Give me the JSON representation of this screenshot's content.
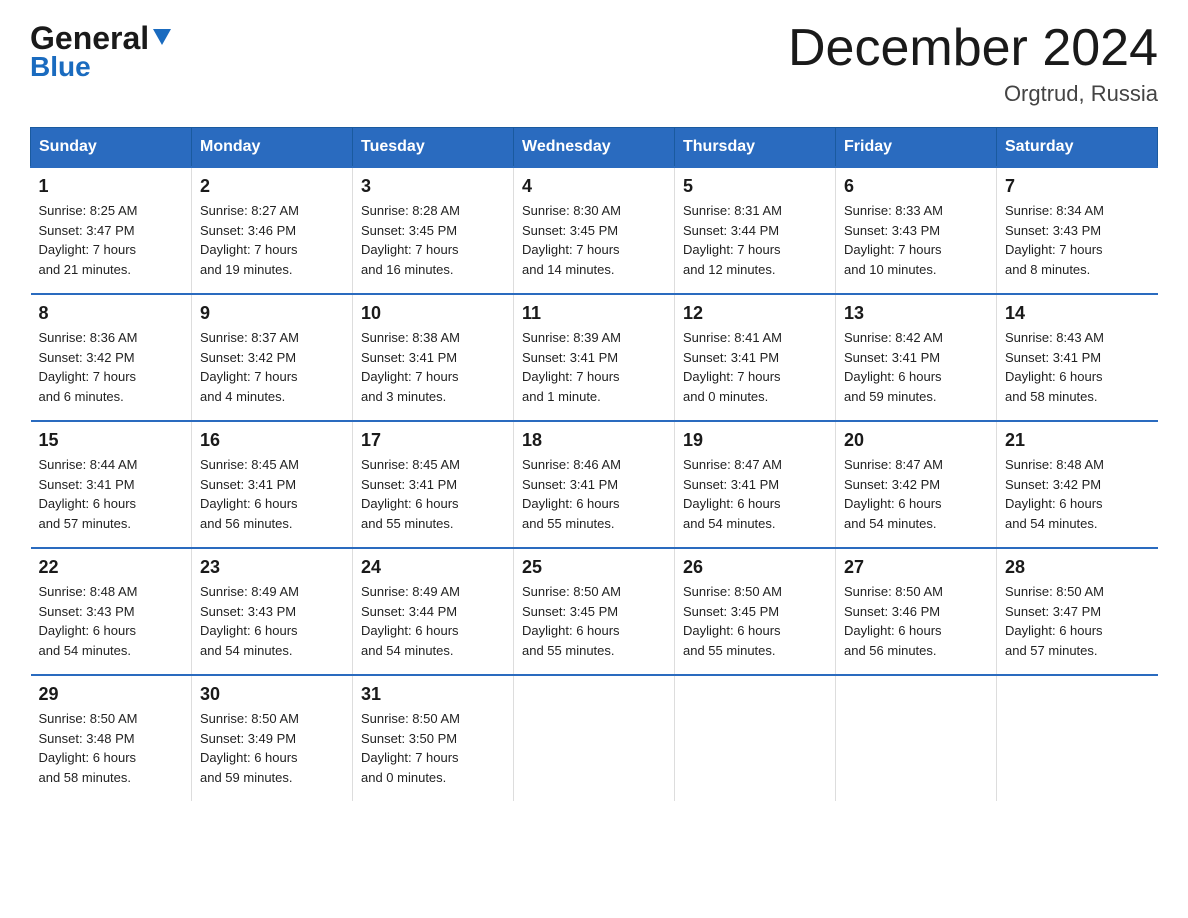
{
  "header": {
    "logo_general": "General",
    "logo_blue": "Blue",
    "title": "December 2024",
    "location": "Orgtrud, Russia"
  },
  "days_of_week": [
    "Sunday",
    "Monday",
    "Tuesday",
    "Wednesday",
    "Thursday",
    "Friday",
    "Saturday"
  ],
  "weeks": [
    [
      {
        "day": "1",
        "sunrise": "8:25 AM",
        "sunset": "3:47 PM",
        "daylight_hours": "7",
        "daylight_minutes": "21"
      },
      {
        "day": "2",
        "sunrise": "8:27 AM",
        "sunset": "3:46 PM",
        "daylight_hours": "7",
        "daylight_minutes": "19"
      },
      {
        "day": "3",
        "sunrise": "8:28 AM",
        "sunset": "3:45 PM",
        "daylight_hours": "7",
        "daylight_minutes": "16"
      },
      {
        "day": "4",
        "sunrise": "8:30 AM",
        "sunset": "3:45 PM",
        "daylight_hours": "7",
        "daylight_minutes": "14"
      },
      {
        "day": "5",
        "sunrise": "8:31 AM",
        "sunset": "3:44 PM",
        "daylight_hours": "7",
        "daylight_minutes": "12"
      },
      {
        "day": "6",
        "sunrise": "8:33 AM",
        "sunset": "3:43 PM",
        "daylight_hours": "7",
        "daylight_minutes": "10"
      },
      {
        "day": "7",
        "sunrise": "8:34 AM",
        "sunset": "3:43 PM",
        "daylight_hours": "7",
        "daylight_minutes": "8"
      }
    ],
    [
      {
        "day": "8",
        "sunrise": "8:36 AM",
        "sunset": "3:42 PM",
        "daylight_hours": "7",
        "daylight_minutes": "6"
      },
      {
        "day": "9",
        "sunrise": "8:37 AM",
        "sunset": "3:42 PM",
        "daylight_hours": "7",
        "daylight_minutes": "4"
      },
      {
        "day": "10",
        "sunrise": "8:38 AM",
        "sunset": "3:41 PM",
        "daylight_hours": "7",
        "daylight_minutes": "3"
      },
      {
        "day": "11",
        "sunrise": "8:39 AM",
        "sunset": "3:41 PM",
        "daylight_hours": "7",
        "daylight_minutes": "1"
      },
      {
        "day": "12",
        "sunrise": "8:41 AM",
        "sunset": "3:41 PM",
        "daylight_hours": "7",
        "daylight_minutes": "0"
      },
      {
        "day": "13",
        "sunrise": "8:42 AM",
        "sunset": "3:41 PM",
        "daylight_hours": "6",
        "daylight_minutes": "59"
      },
      {
        "day": "14",
        "sunrise": "8:43 AM",
        "sunset": "3:41 PM",
        "daylight_hours": "6",
        "daylight_minutes": "58"
      }
    ],
    [
      {
        "day": "15",
        "sunrise": "8:44 AM",
        "sunset": "3:41 PM",
        "daylight_hours": "6",
        "daylight_minutes": "57"
      },
      {
        "day": "16",
        "sunrise": "8:45 AM",
        "sunset": "3:41 PM",
        "daylight_hours": "6",
        "daylight_minutes": "56"
      },
      {
        "day": "17",
        "sunrise": "8:45 AM",
        "sunset": "3:41 PM",
        "daylight_hours": "6",
        "daylight_minutes": "55"
      },
      {
        "day": "18",
        "sunrise": "8:46 AM",
        "sunset": "3:41 PM",
        "daylight_hours": "6",
        "daylight_minutes": "55"
      },
      {
        "day": "19",
        "sunrise": "8:47 AM",
        "sunset": "3:41 PM",
        "daylight_hours": "6",
        "daylight_minutes": "54"
      },
      {
        "day": "20",
        "sunrise": "8:47 AM",
        "sunset": "3:42 PM",
        "daylight_hours": "6",
        "daylight_minutes": "54"
      },
      {
        "day": "21",
        "sunrise": "8:48 AM",
        "sunset": "3:42 PM",
        "daylight_hours": "6",
        "daylight_minutes": "54"
      }
    ],
    [
      {
        "day": "22",
        "sunrise": "8:48 AM",
        "sunset": "3:43 PM",
        "daylight_hours": "6",
        "daylight_minutes": "54"
      },
      {
        "day": "23",
        "sunrise": "8:49 AM",
        "sunset": "3:43 PM",
        "daylight_hours": "6",
        "daylight_minutes": "54"
      },
      {
        "day": "24",
        "sunrise": "8:49 AM",
        "sunset": "3:44 PM",
        "daylight_hours": "6",
        "daylight_minutes": "54"
      },
      {
        "day": "25",
        "sunrise": "8:50 AM",
        "sunset": "3:45 PM",
        "daylight_hours": "6",
        "daylight_minutes": "55"
      },
      {
        "day": "26",
        "sunrise": "8:50 AM",
        "sunset": "3:45 PM",
        "daylight_hours": "6",
        "daylight_minutes": "55"
      },
      {
        "day": "27",
        "sunrise": "8:50 AM",
        "sunset": "3:46 PM",
        "daylight_hours": "6",
        "daylight_minutes": "56"
      },
      {
        "day": "28",
        "sunrise": "8:50 AM",
        "sunset": "3:47 PM",
        "daylight_hours": "6",
        "daylight_minutes": "57"
      }
    ],
    [
      {
        "day": "29",
        "sunrise": "8:50 AM",
        "sunset": "3:48 PM",
        "daylight_hours": "6",
        "daylight_minutes": "58"
      },
      {
        "day": "30",
        "sunrise": "8:50 AM",
        "sunset": "3:49 PM",
        "daylight_hours": "6",
        "daylight_minutes": "59"
      },
      {
        "day": "31",
        "sunrise": "8:50 AM",
        "sunset": "3:50 PM",
        "daylight_hours": "7",
        "daylight_minutes": "0"
      },
      null,
      null,
      null,
      null
    ]
  ]
}
